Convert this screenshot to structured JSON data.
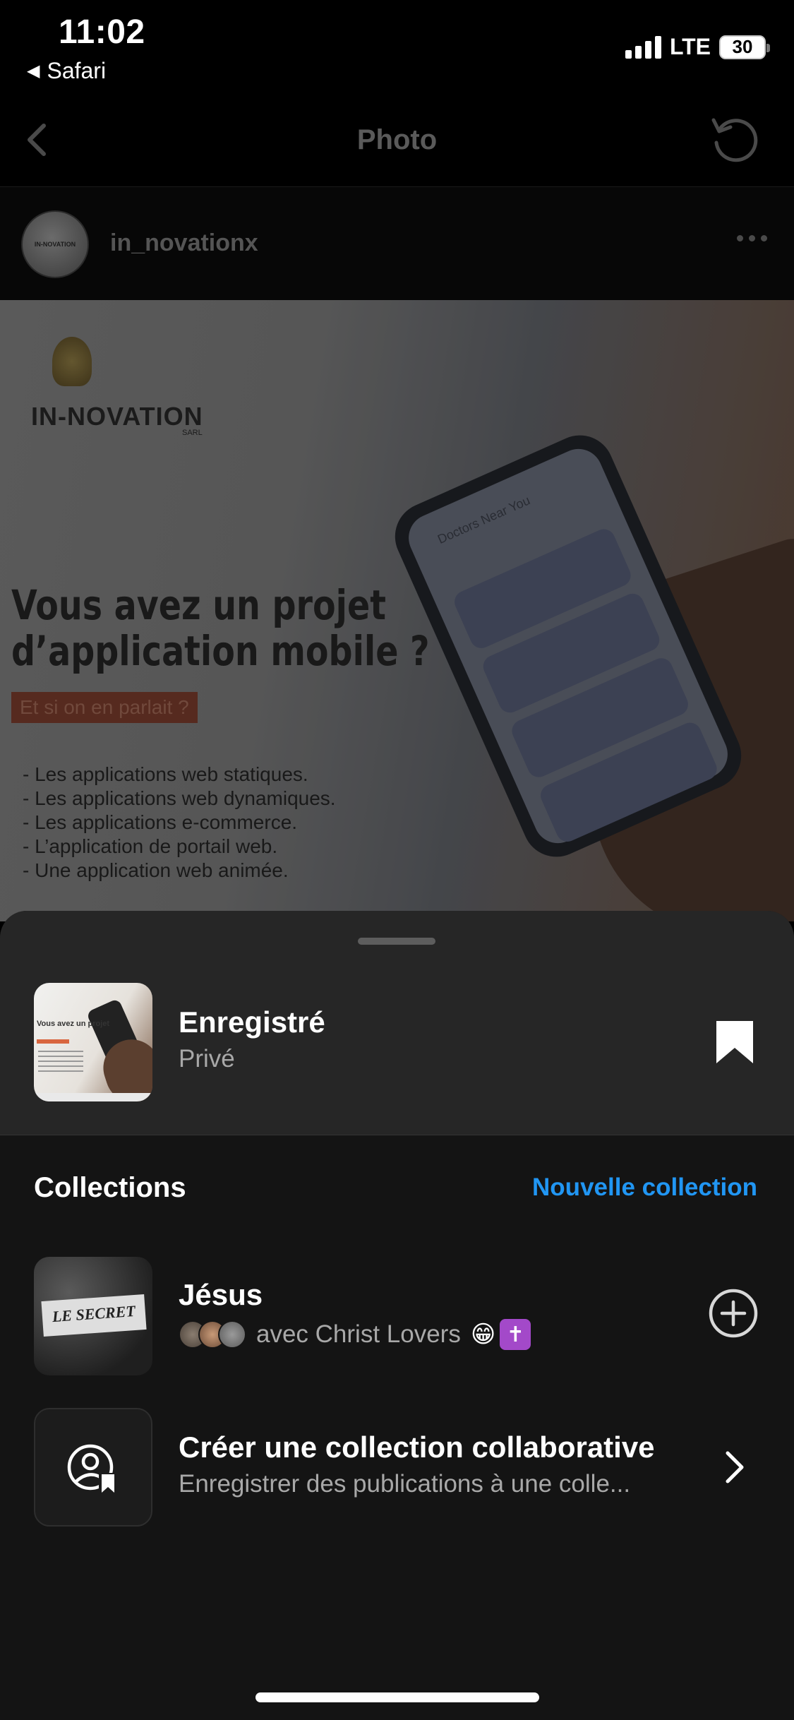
{
  "status_bar": {
    "time": "11:02",
    "back_app": "Safari",
    "network": "LTE",
    "battery": "30"
  },
  "nav": {
    "title": "Photo"
  },
  "post": {
    "username": "in_novationx",
    "logo_text": "IN-NOVATION",
    "logo_sub": "SARL",
    "headline_line1": "Vous avez un projet",
    "headline_line2": "d’application mobile ?",
    "tagline": "Et si on en parlait ?",
    "bullets": [
      "- Les applications web statiques.",
      "- Les applications web dynamiques.",
      "- Les applications e-commerce.",
      "- L’application de portail web.",
      "- Une application web animée."
    ],
    "phone_header": "Doctors Near You"
  },
  "sheet": {
    "saved_title": "Enregistré",
    "saved_subtitle": "Privé",
    "collections_label": "Collections",
    "new_collection_label": "Nouvelle collection",
    "collections": [
      {
        "title": "Jésus",
        "thumb_text": "LE SECRET",
        "subtitle": "avec Christ Lovers",
        "emoji": "😁",
        "emoji2": "✝"
      }
    ],
    "collab": {
      "title": "Créer une collection collaborative",
      "subtitle": "Enregistrer des publications à une colle..."
    }
  },
  "colors": {
    "accent": "#2196f3",
    "sheet_bg": "#141414",
    "sheet_top_bg": "#262626"
  }
}
